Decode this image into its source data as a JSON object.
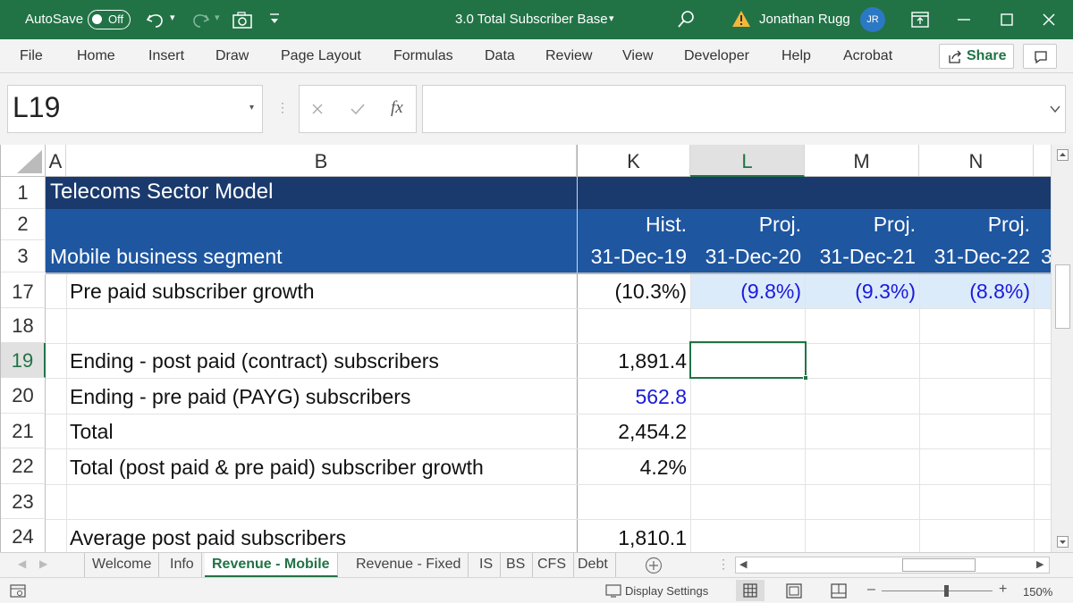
{
  "titlebar": {
    "autosave_label": "AutoSave",
    "autosave_state": "Off",
    "file_title": "3.0 Total Subscriber Base",
    "user_name": "Jonathan Rugg",
    "user_initials": "JR"
  },
  "menu": {
    "items": [
      "File",
      "Home",
      "Insert",
      "Draw",
      "Page Layout",
      "Formulas",
      "Data",
      "Review",
      "View",
      "Developer",
      "Help",
      "Acrobat"
    ],
    "share_label": "Share"
  },
  "formula_bar": {
    "name_box": "L19",
    "fx_label": "fx",
    "formula": ""
  },
  "grid": {
    "columns": [
      "A",
      "B",
      "K",
      "L",
      "M",
      "N"
    ],
    "selected_column": "L",
    "row1": {
      "num": "1",
      "title": "Telecoms Sector Model"
    },
    "row2": {
      "num": "2",
      "k": "Hist.",
      "l": "Proj.",
      "m": "Proj.",
      "n": "Proj."
    },
    "row3": {
      "num": "3",
      "b": "Mobile business segment",
      "k": "31-Dec-19",
      "l": "31-Dec-20",
      "m": "31-Dec-21",
      "n": "31-Dec-22",
      "overflow": "3"
    },
    "rows": [
      {
        "num": "17",
        "b": "Pre paid subscriber growth",
        "k": "(10.3%)",
        "l": "(9.8%)",
        "m": "(9.3%)",
        "n": "(8.8%)"
      },
      {
        "num": "18",
        "b": "",
        "k": "",
        "l": "",
        "m": "",
        "n": ""
      },
      {
        "num": "19",
        "b": "Ending - post paid (contract) subscribers",
        "k": "1,891.4",
        "l": "",
        "m": "",
        "n": ""
      },
      {
        "num": "20",
        "b": "Ending - pre paid (PAYG) subscribers",
        "k": "562.8",
        "l": "",
        "m": "",
        "n": ""
      },
      {
        "num": "21",
        "b": "Total",
        "k": "2,454.2",
        "l": "",
        "m": "",
        "n": ""
      },
      {
        "num": "22",
        "b": "Total (post paid & pre paid) subscriber growth",
        "k": "4.2%",
        "l": "",
        "m": "",
        "n": ""
      },
      {
        "num": "23",
        "b": "",
        "k": "",
        "l": "",
        "m": "",
        "n": ""
      },
      {
        "num": "24",
        "b": "Average post paid subscribers",
        "k": "1,810.1",
        "l": "",
        "m": "",
        "n": ""
      }
    ],
    "colors": {
      "dark_navy": "#1a3a6e",
      "blue_band": "#1e56a0",
      "input_blue": "#1a1adc",
      "proj_bg": "#dcebfa"
    }
  },
  "tabs": {
    "items": [
      "Welcome",
      "Info",
      "Revenue - Mobile",
      "Revenue - Fixed",
      "IS",
      "BS",
      "CFS",
      "Debt"
    ],
    "active": "Revenue - Mobile"
  },
  "status": {
    "display_settings": "Display Settings",
    "zoom": "150%"
  }
}
